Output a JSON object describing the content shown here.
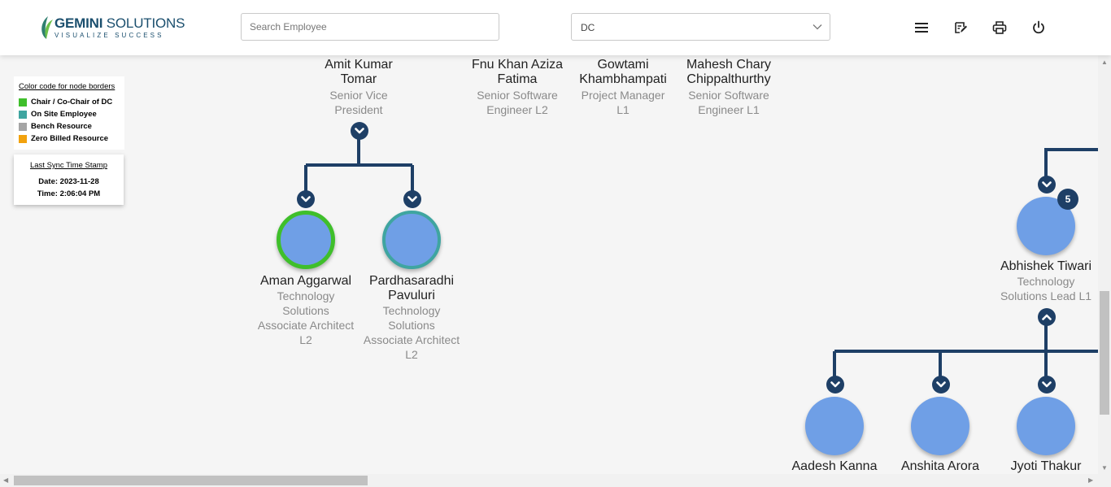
{
  "header": {
    "logo": {
      "brand": "GEMINI",
      "brand_suffix": " SOLUTIONS",
      "tagline": "VISUALIZE SUCCESS"
    },
    "search": {
      "placeholder": "Search Employee",
      "value": ""
    },
    "dc_select": {
      "selected": "DC"
    },
    "actions": [
      "menu-icon",
      "edit-note-icon",
      "print-icon",
      "power-icon"
    ]
  },
  "legend": {
    "title": "Color code for node borders",
    "items": [
      {
        "label": "Chair / Co-Chair of DC",
        "color": "#3fbf2b"
      },
      {
        "label": "On Site Employee",
        "color": "#3fa5a0"
      },
      {
        "label": "Bench Resource",
        "color": "#a5a5a5"
      },
      {
        "label": "Zero Billed Resource",
        "color": "#f2a20d"
      }
    ]
  },
  "sync": {
    "title": "Last Sync Time Stamp",
    "date": "Date: 2023-11-28",
    "time": "Time: 2:06:04 PM"
  },
  "top_row": [
    {
      "name_line1": "Amit Kumar",
      "name_line2": "Tomar",
      "role_line1": "Senior Vice",
      "role_line2": "President"
    },
    {
      "name_line1": "Fnu Khan Aziza",
      "name_line2": "Fatima",
      "role_line1": "Senior Software",
      "role_line2": "Engineer L2"
    },
    {
      "name_line1": "Gowtami",
      "name_line2": "Khambhampati",
      "role_line1": "Project Manager",
      "role_line2": "L1"
    },
    {
      "name_line1": "Mahesh Chary",
      "name_line2": "Chippalthurthy",
      "role_line1": "Senior Software",
      "role_line2": "Engineer L1"
    }
  ],
  "children": [
    {
      "name": "Aman Aggarwal",
      "role_lines": [
        "Technology",
        "Solutions",
        "Associate Architect",
        "L2"
      ],
      "border": "#3fbf2b"
    },
    {
      "name_lines": [
        "Pardhasaradhi",
        "Pavuluri"
      ],
      "role_lines": [
        "Technology",
        "Solutions",
        "Associate Architect",
        "L2"
      ],
      "border": "#3fa5a0"
    }
  ],
  "right_node": {
    "name": "Abhishek Tiwari",
    "role_lines": [
      "Technology",
      "Solutions Lead L1"
    ],
    "badge": "5"
  },
  "bottom_row": [
    {
      "name": "Aadesh Kanna"
    },
    {
      "name": "Anshita Arora"
    },
    {
      "name": "Jyoti Thakur"
    }
  ],
  "colors": {
    "connector": "#1e3f66",
    "node_fill": "#6f9fe6",
    "background": "#f5f5f5"
  }
}
